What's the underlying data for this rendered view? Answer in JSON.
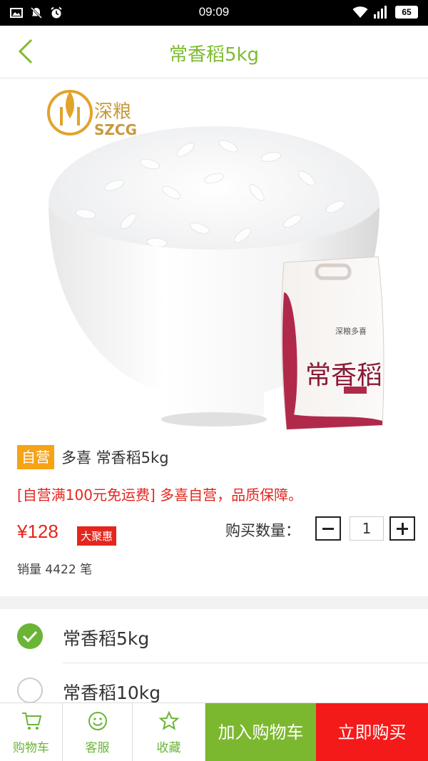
{
  "status_bar": {
    "time": "09:09",
    "battery": "65",
    "left_icons": [
      "image-icon",
      "notification-off-icon",
      "alarm-icon"
    ],
    "right_icons": [
      "wifi-icon",
      "signal-icon",
      "battery-icon"
    ]
  },
  "nav": {
    "title": "常香稻5kg",
    "back_icon": "chevron-left-icon"
  },
  "product_image": {
    "brand_logo_text": "深粮",
    "brand_logo_sub": "SZCG",
    "bag_text_brand": "深粮多喜",
    "bag_text_name": "常香稻"
  },
  "product": {
    "self_badge": "自营",
    "title": "多喜 常香稻5kg",
    "promo": "[自营满100元免运费] 多喜自营，品质保障。",
    "price": "¥128",
    "deal_badge": "大聚惠",
    "qty_label": "购买数量：",
    "qty_value": "1",
    "sales": "销量 4422 笔"
  },
  "options": [
    {
      "label": "常香稻5kg",
      "selected": true
    },
    {
      "label": "常香稻10kg",
      "selected": false
    }
  ],
  "bottom_bar": {
    "cart": "购物车",
    "service": "客服",
    "favorite": "收藏",
    "add_to_cart": "加入购物车",
    "buy_now": "立即购买"
  },
  "colors": {
    "accent_green": "#7cb82f",
    "price_red": "#e4261d",
    "buy_red": "#f51a1a",
    "badge_orange": "#f6a317"
  }
}
